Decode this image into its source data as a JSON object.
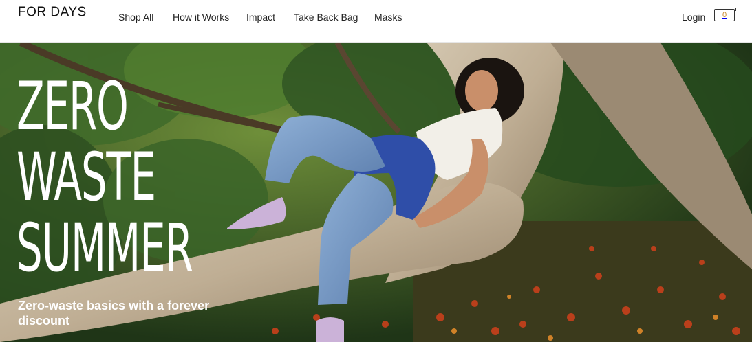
{
  "brand": {
    "logo_text": "FOR DAYS"
  },
  "nav": {
    "items": [
      {
        "label": "Shop All"
      },
      {
        "label": "How it Works"
      },
      {
        "label": "Impact"
      },
      {
        "label": "Take Back Bag"
      },
      {
        "label": "Masks"
      }
    ]
  },
  "account": {
    "login_label": "Login",
    "cart_count": "0"
  },
  "hero": {
    "title_lines": [
      "ZERO",
      "WASTE",
      "SUMMER"
    ],
    "subtitle": "Zero-waste basics with a forever discount"
  },
  "colors": {
    "header_bg": "#ffffff",
    "text": "#222222",
    "cart_count": "#c98a2b",
    "hero_text": "#ffffff",
    "foliage": "#2d4a22"
  }
}
